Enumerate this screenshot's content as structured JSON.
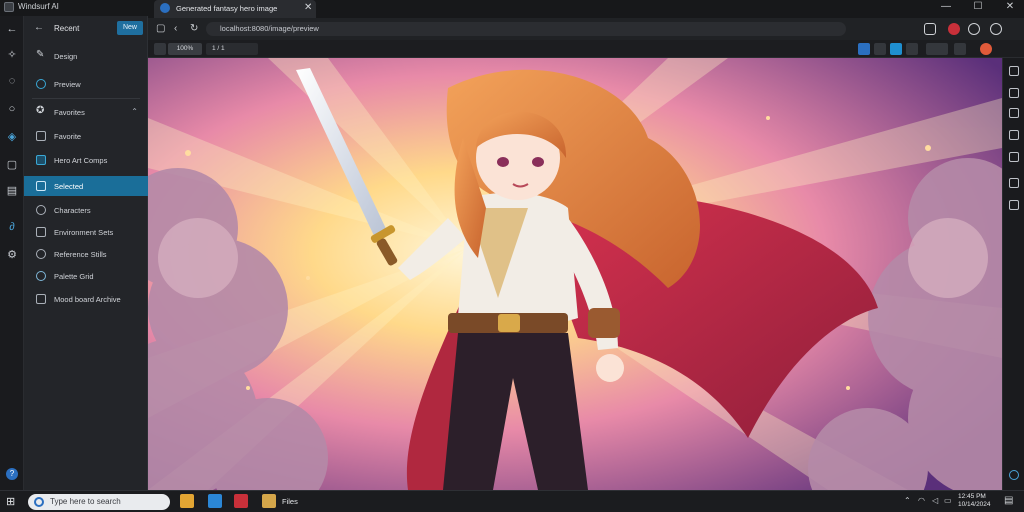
{
  "app": {
    "title": "Windsurf AI"
  },
  "window_controls": {
    "minimize": "—",
    "maximize": "☐",
    "close": "✕"
  },
  "tab": {
    "title": "Generated fantasy hero image",
    "close": "✕"
  },
  "addressbar": {
    "url": "localhost:8080/image/preview"
  },
  "toolbar2": {
    "zoom": "100%",
    "page_indicator": "1 / 1"
  },
  "sidebar": {
    "header_title": "Recent",
    "header_button": "New",
    "items": [
      {
        "label": "Design",
        "icon": "brush-icon"
      },
      {
        "label": "Preview",
        "icon": "eye-icon"
      },
      {
        "label": "Favorites",
        "icon": "star-icon",
        "expand": "⌃"
      },
      {
        "label": "Favorite",
        "icon": "bookmark-icon"
      },
      {
        "label": "Hero Art Comps",
        "icon": "folder-icon"
      },
      {
        "label": "Selected",
        "icon": "image-icon",
        "active": true
      },
      {
        "label": "Characters",
        "icon": "person-icon"
      },
      {
        "label": "Environment Sets",
        "icon": "mountain-icon"
      },
      {
        "label": "Reference Stills",
        "icon": "film-icon"
      },
      {
        "label": "Palette Grid",
        "icon": "palette-icon"
      },
      {
        "label": "Mood board Archive",
        "icon": "archive-icon"
      }
    ]
  },
  "taskbar": {
    "search_placeholder": "Type here to search",
    "app_label": "Files",
    "time": "12:45 PM",
    "date": "10/14/2024"
  },
  "colors": {
    "accent": "#1a6e99",
    "background": "#1e1f22",
    "sidebar": "#232529"
  }
}
